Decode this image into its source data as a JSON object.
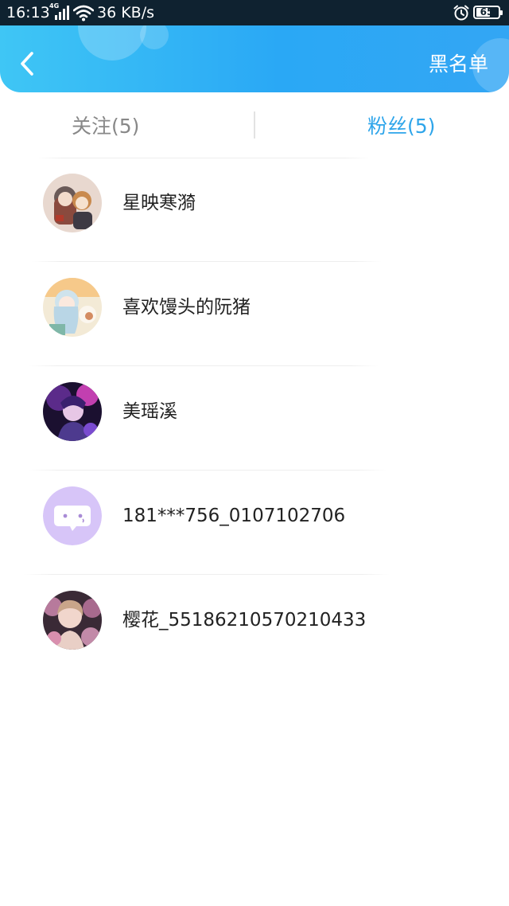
{
  "status_bar": {
    "time": "16:13",
    "network": "4G",
    "speed": "36 KB/s",
    "battery": "65",
    "battery_fraction": 0.65
  },
  "header": {
    "back_icon": "chevron-left-icon",
    "blacklist_label": "黑名单",
    "accent_color": "#2aa8f5"
  },
  "tabs": [
    {
      "label": "关注(5)",
      "active": false
    },
    {
      "label": "粉丝(5)",
      "active": true
    }
  ],
  "fans": [
    {
      "name": "星映寒漪",
      "avatar": "anime-duo-avatar"
    },
    {
      "name": "喜欢馒头的阮猪",
      "avatar": "anime-girl-avatar"
    },
    {
      "name": "美瑶溪",
      "avatar": "purple-hero-avatar"
    },
    {
      "name": "181***756_0107102706",
      "avatar": "default-chat-avatar"
    },
    {
      "name": "樱花_55186210570210433",
      "avatar": "portrait-flowers-avatar"
    }
  ]
}
